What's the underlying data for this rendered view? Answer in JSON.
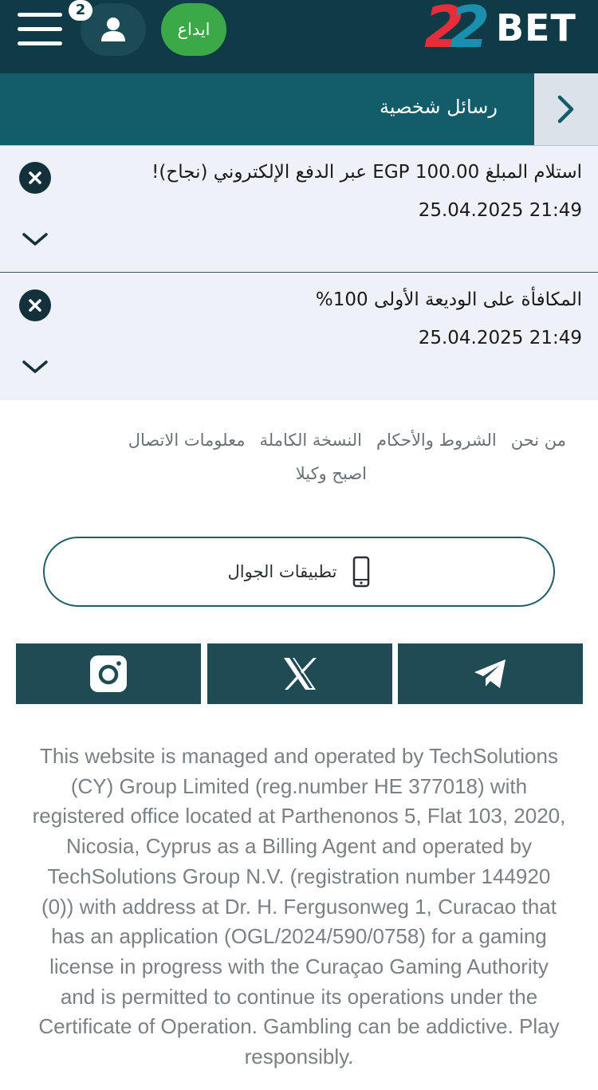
{
  "header": {
    "notification_count": "2",
    "deposit_label": "ايداع",
    "logo": {
      "number": "22",
      "word": "BET"
    }
  },
  "section": {
    "title": "رسائل شخصية"
  },
  "messages": [
    {
      "title": "استلام المبلغ 100.00 EGP عبر الدفع الإلكتروني (نجاح)!",
      "date": "25.04.2025 21:49"
    },
    {
      "title": "المكافأة على الوديعة الأولى 100%",
      "date": "25.04.2025 21:49"
    }
  ],
  "footer": {
    "links": [
      "من نحن",
      "الشروط والأحكام",
      "النسخة الكاملة",
      "معلومات الاتصال"
    ],
    "agent_link": "اصبح وكيلا",
    "mobile_apps": "تطبيقات الجوال"
  },
  "social": [
    "instagram-icon",
    "x-icon",
    "telegram-icon"
  ],
  "legal_text": "This website is managed and operated by TechSolutions (CY) Group Limited (reg.number HE 377018) with registered office located at Parthenonos 5, Flat 103, 2020, Nicosia, Cyprus as a Billing Agent and operated by TechSolutions Group N.V. (registration number 144920 (0)) with address at Dr. H. Fergusonweg 1, Curacao that has an application (OGL/2024/590/0758) for a gaming license in progress with the Curaçao Gaming Authority and is permitted to continue its operations under the Certificate of Operation. Gambling can be addictive. Play responsibly.",
  "colors": {
    "header_bg": "#0f3b46",
    "section_bg": "#135d6a",
    "deposit_green": "#3ba947",
    "message_bg": "#eef1f7",
    "social_bg": "#1f4b55"
  }
}
